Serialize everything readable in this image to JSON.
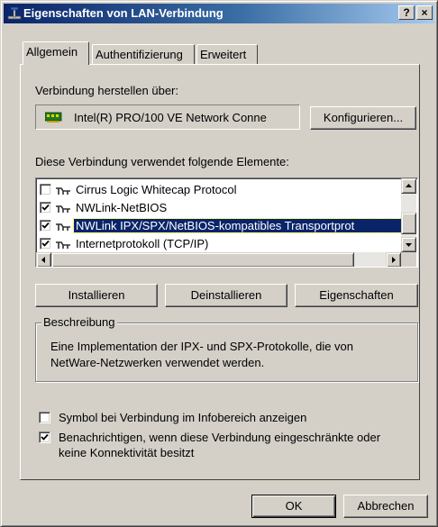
{
  "window": {
    "title": "Eigenschaften von LAN-Verbindung",
    "help_button": "?",
    "close_button": "×"
  },
  "tabs": [
    {
      "label": "Allgemein",
      "active": true
    },
    {
      "label": "Authentifizierung",
      "active": false
    },
    {
      "label": "Erweitert",
      "active": false
    }
  ],
  "connect_using": {
    "label": "Verbindung herstellen über:",
    "adapter": "Intel(R) PRO/100 VE Network Conne",
    "configure_button": "Konfigurieren..."
  },
  "components": {
    "label": "Diese Verbindung verwendet folgende Elemente:",
    "items": [
      {
        "label": "Cirrus Logic Whitecap Protocol",
        "checked": false,
        "selected": false
      },
      {
        "label": "NWLink-NetBIOS",
        "checked": true,
        "selected": false
      },
      {
        "label": "NWLink IPX/SPX/NetBIOS-kompatibles Transportprot",
        "checked": true,
        "selected": true
      },
      {
        "label": "Internetprotokoll (TCP/IP)",
        "checked": true,
        "selected": false
      }
    ]
  },
  "buttons": {
    "install": "Installieren",
    "uninstall": "Deinstallieren",
    "properties": "Eigenschaften"
  },
  "description": {
    "title": "Beschreibung",
    "text_line1": "Eine Implementation der IPX- und SPX-Protokolle, die von",
    "text_line2": "NetWare-Netzwerken verwendet werden."
  },
  "options": {
    "show_icon": {
      "label": "Symbol bei Verbindung im Infobereich anzeigen",
      "checked": false
    },
    "notify": {
      "label_line1": "Benachrichtigen, wenn diese Verbindung eingeschränkte oder",
      "label_line2": "keine Konnektivität besitzt",
      "checked": true
    }
  },
  "footer": {
    "ok": "OK",
    "cancel": "Abbrechen"
  },
  "colors": {
    "face": "#d4d0c8",
    "titlebar_start": "#0a246a",
    "titlebar_end": "#a6caf0",
    "selection": "#0a246a"
  }
}
